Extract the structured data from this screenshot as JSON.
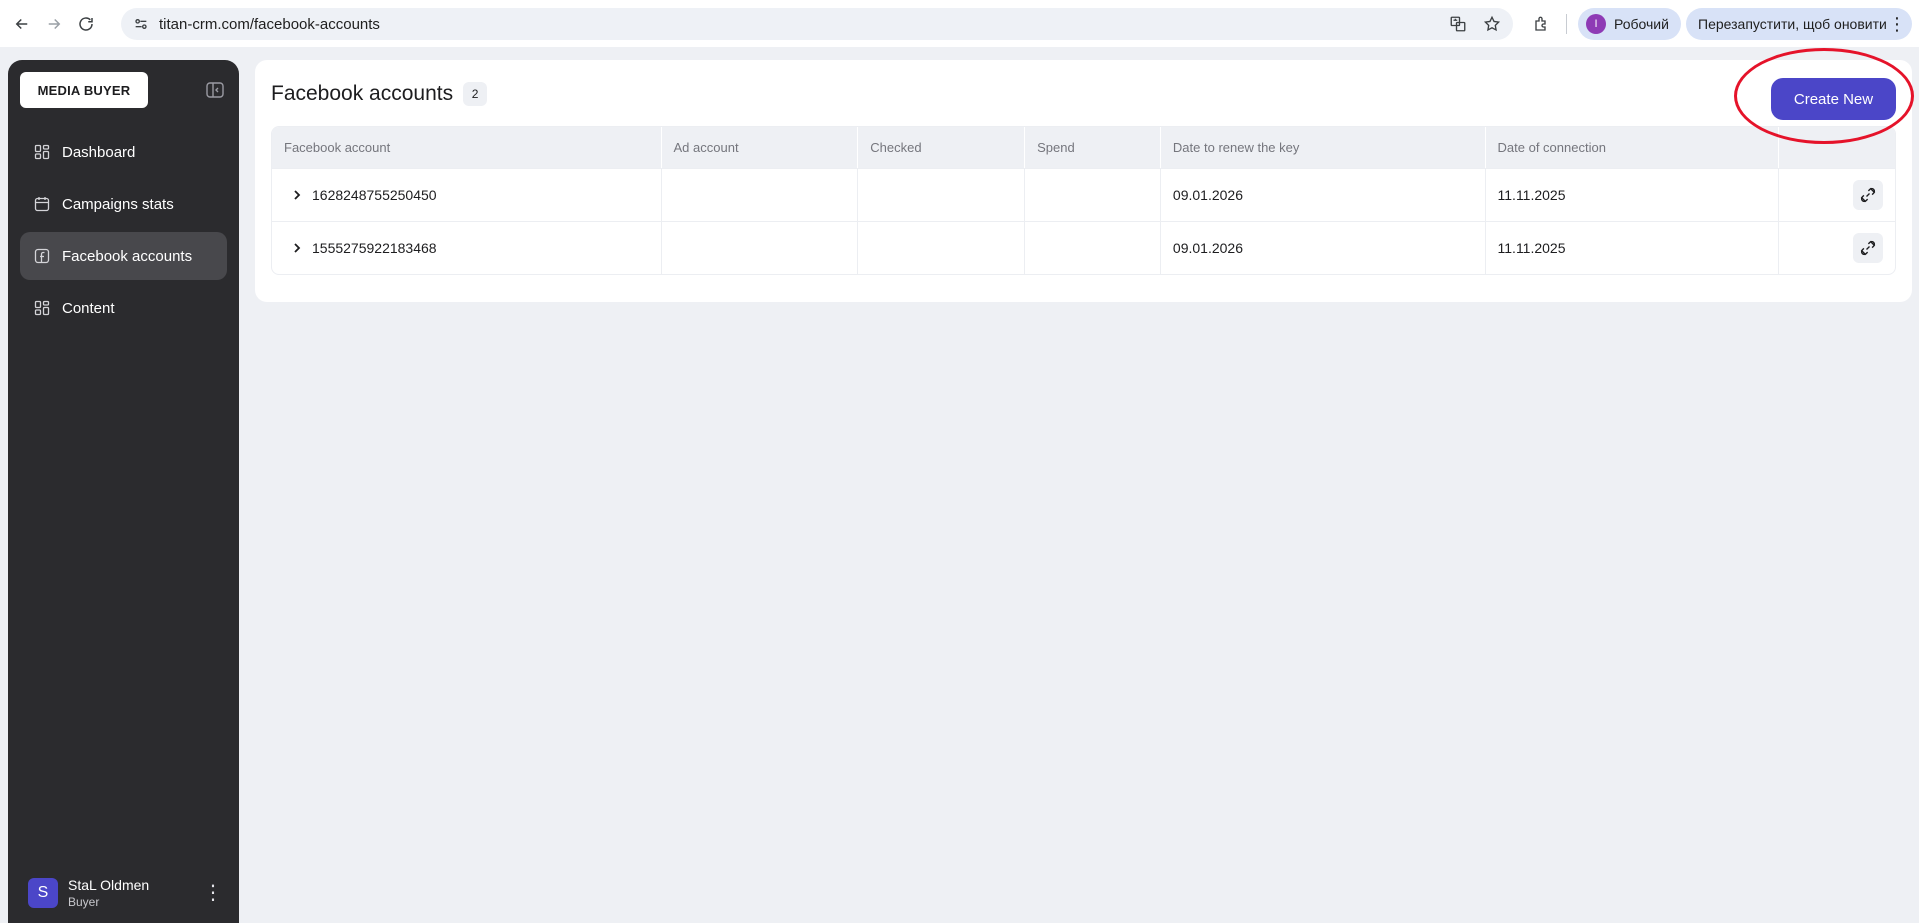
{
  "browser": {
    "url": "titan-crm.com/facebook-accounts",
    "profile_initial": "I",
    "profile_label": "Робочий",
    "update_label": "Перезапустити, щоб оновити"
  },
  "sidebar": {
    "brand": "MEDIA BUYER",
    "items": [
      {
        "label": "Dashboard",
        "icon": "grid-icon",
        "active": false
      },
      {
        "label": "Campaigns stats",
        "icon": "calendar-icon",
        "active": false
      },
      {
        "label": "Facebook accounts",
        "icon": "facebook-icon",
        "active": true
      },
      {
        "label": "Content",
        "icon": "grid-icon",
        "active": false
      }
    ],
    "user": {
      "initial": "S",
      "name": "StaL Oldmen",
      "role": "Buyer"
    }
  },
  "main": {
    "title": "Facebook accounts",
    "count": "2",
    "create_label": "Create New",
    "columns": [
      "Facebook account",
      "Ad account",
      "Checked",
      "Spend",
      "Date to renew the key",
      "Date of connection",
      ""
    ],
    "rows": [
      {
        "account": "1628248755250450",
        "ad_account": "",
        "checked": "",
        "spend": "",
        "renew": "09.01.2026",
        "connected": "11.11.2025"
      },
      {
        "account": "1555275922183468",
        "ad_account": "",
        "checked": "",
        "spend": "",
        "renew": "09.01.2026",
        "connected": "11.11.2025"
      }
    ]
  },
  "colors": {
    "accent": "#4b46c8",
    "sidebar": "#2b2b2e",
    "highlight": "#e5132a"
  }
}
